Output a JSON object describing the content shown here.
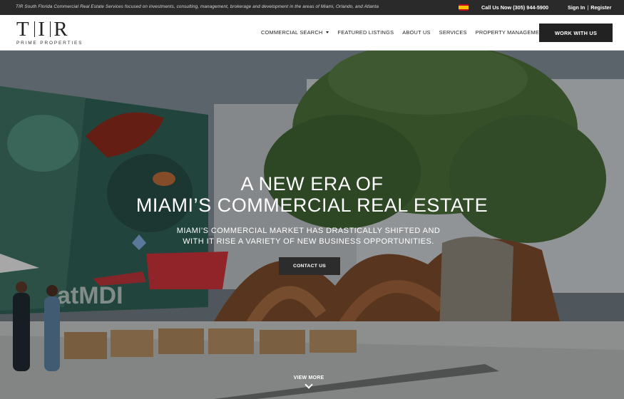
{
  "topbar": {
    "tagline": "TIR South Florida Commercial Real Estate Services focused on investments, consulting, management, brokerage and development in the areas of Miami, Orlando, and Atlanta",
    "language_icon": "spain-flag-icon",
    "phone": "Call Us Now (305) 944-5900",
    "sign_in": "Sign In",
    "separator": "|",
    "register": "Register"
  },
  "header": {
    "logo_mark": [
      "T",
      "I",
      "R"
    ],
    "logo_sub": "PRIME PROPERTIES",
    "nav": [
      {
        "label": "COMMERCIAL SEARCH",
        "dropdown": true
      },
      {
        "label": "FEATURED LISTINGS"
      },
      {
        "label": "ABOUT US"
      },
      {
        "label": "SERVICES"
      },
      {
        "label": "PROPERTY MANAGEMENT"
      }
    ],
    "cta": "WORK WITH US"
  },
  "hero": {
    "title_line1": "A NEW ERA OF",
    "title_line2": "MIAMI’S COMMERCIAL REAL ESTATE",
    "subtitle_line1": "MIAMI’S COMMERCIAL MARKET HAS DRASTICALLY SHIFTED AND",
    "subtitle_line2": "WITH IT RISE A VARIETY OF NEW BUSINESS OPPORTUNITIES.",
    "contact_button": "CONTACT US",
    "view_more": "VIEW MORE",
    "mural_text": "atMDI"
  },
  "colors": {
    "topbar_bg": "#2a2a2a",
    "header_bg": "#ffffff",
    "dark_button": "#222222",
    "hero_text": "#ffffff"
  }
}
